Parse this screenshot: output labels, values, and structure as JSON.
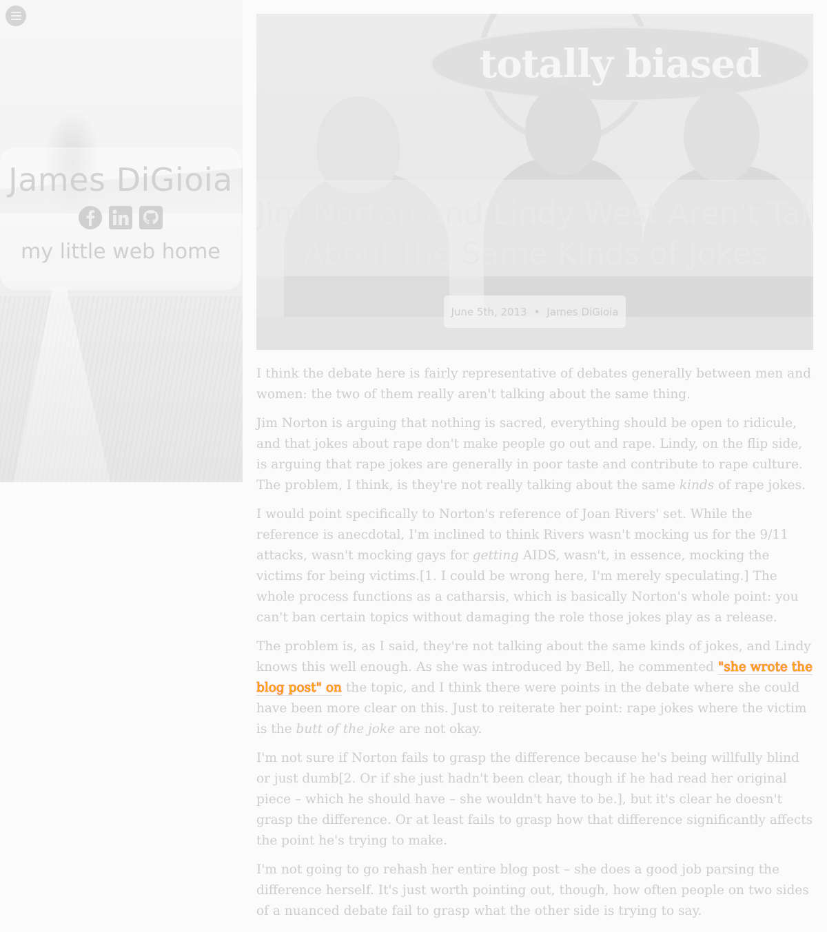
{
  "sidebar": {
    "site_name": "James DiGioia",
    "tagline": "my little web home",
    "social": [
      {
        "name": "Facebook",
        "icon": "facebook-icon"
      },
      {
        "name": "LinkedIn",
        "icon": "linkedin-icon"
      },
      {
        "name": "GitHub",
        "icon": "github-icon"
      }
    ]
  },
  "hero": {
    "banner_text": "totally biased"
  },
  "post": {
    "title_line1": "Jim Norton and Lindy West Aren't Talking",
    "title_line2": "About the Same Kinds of Jokes",
    "date": "June 5th, 2013",
    "separator": "•",
    "author": "James DiGioia"
  },
  "article": {
    "p1": "I think the debate here is fairly representative of debates generally between men and women: the two of them really aren't talking about the same thing.",
    "p2_a": "Jim Norton is arguing that nothing is sacred, everything should be open to ridicule, and that jokes about rape don't make people go out and rape. Lindy, on the flip side, is arguing that rape jokes are generally in poor taste and contribute to rape culture. The problem, I think, is they're not really talking about the same ",
    "p2_em": "kinds",
    "p2_b": " of rape jokes.",
    "p3_a": "I would point specifically to Norton's reference of Joan Rivers' set. While the reference is anecdotal, I'm inclined to think Rivers wasn't mocking us for the 9/11 attacks, wasn't mocking gays for ",
    "p3_em": "getting",
    "p3_b": " AIDS, wasn't, in essence, mocking the victims for being victims.[1. I could be wrong here, I'm merely speculating.] The whole process functions as a catharsis, which is basically Norton's whole point: you can't ban certain topics without damaging the role those jokes play as a release.",
    "p4_a": "The problem is, as I said, they're not talking about the same kinds of jokes, and Lindy knows this well enough. As she was introduced by Bell, he commented ",
    "p4_link": "\"she wrote the blog post\" on",
    "p4_b": " the topic, and I think there were points in the debate where she could have been more clear on this. Just to reiterate her point: rape jokes where the victim is the ",
    "p4_em": "butt of the joke",
    "p4_c": " are not okay.",
    "p5": "I'm not sure if Norton fails to grasp the difference because he's being willfully blind or just dumb[2. Or if she just hadn't been clear, though if he had read her original piece – which he should have – she wouldn't have to be.], but it's clear he doesn't grasp the difference. Or at least fails to grasp how that difference significantly affects the point he's trying to make.",
    "p6": "I'm not going to go rehash her entire blog post – she does a good job parsing the difference herself. It's just worth pointing out, though, how often people on two sides of a nuanced debate fail to grasp what the other side is trying to say."
  },
  "colors": {
    "page_bg": "#fbfbfb",
    "faded_text": "#cdcdcd",
    "highlight_text": "#ffb800",
    "highlight_outline": "#e00000"
  }
}
